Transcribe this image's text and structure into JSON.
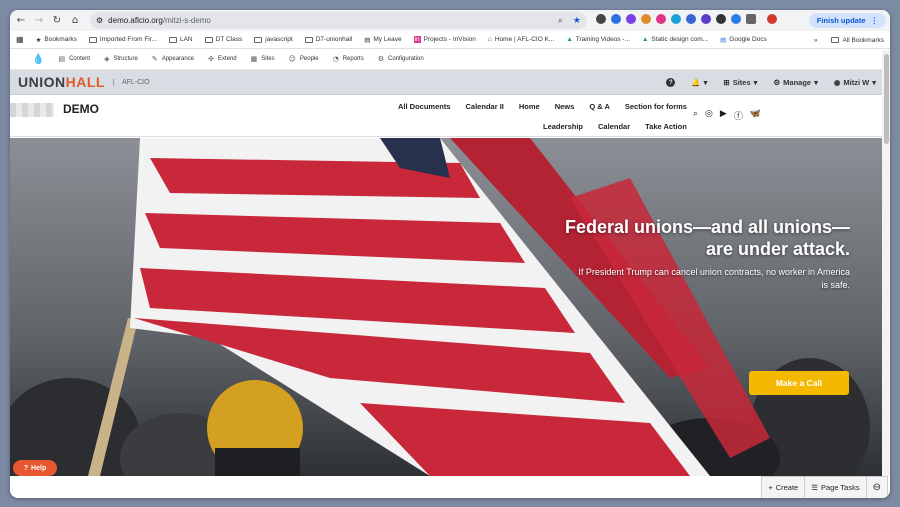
{
  "browser": {
    "url_host": "demo.aflcio.org",
    "url_path": "/mitzi-s-demo",
    "finish_update": "Finish update"
  },
  "bookmarks": {
    "items": [
      "Bookmarks",
      "Imported From Fir...",
      "LAN",
      "DT Class",
      "javascript",
      "D7-unionhall",
      "My Leave",
      "Projects - InVision",
      "Home | AFL-CIO K...",
      "Training Videos -...",
      "Static design com...",
      "Google Docs"
    ],
    "overflow": "»",
    "all": "All Bookmarks"
  },
  "admin": {
    "items": [
      "Content",
      "Structure",
      "Appearance",
      "Extend",
      "Sites",
      "People",
      "Reports",
      "Configuration"
    ]
  },
  "unionhall": {
    "logo_union": "UNION",
    "logo_hall": "HALL",
    "org": "AFL-CIO",
    "help": "?",
    "notify": "▾",
    "sites": "Sites",
    "manage": "Manage",
    "user": "Mitzi W"
  },
  "site": {
    "name": "DEMO",
    "menu_row1": [
      "All Documents",
      "Calendar II",
      "Home",
      "News",
      "Q & A",
      "Section for forms"
    ],
    "menu_row2": [
      "Leadership",
      "Calendar",
      "Take Action"
    ]
  },
  "hero": {
    "headline": "Federal unions—and all unions—are under attack.",
    "subtext": "If President Trump can cancel union contracts, no worker in America is safe.",
    "cta": "Make a Call"
  },
  "help_button": "Help",
  "bottom": {
    "create": "Create",
    "page_tasks": "Page Tasks"
  },
  "colors": {
    "accent_orange": "#e05a2b",
    "cta_yellow": "#f5b800",
    "help_red": "#e8572f"
  }
}
